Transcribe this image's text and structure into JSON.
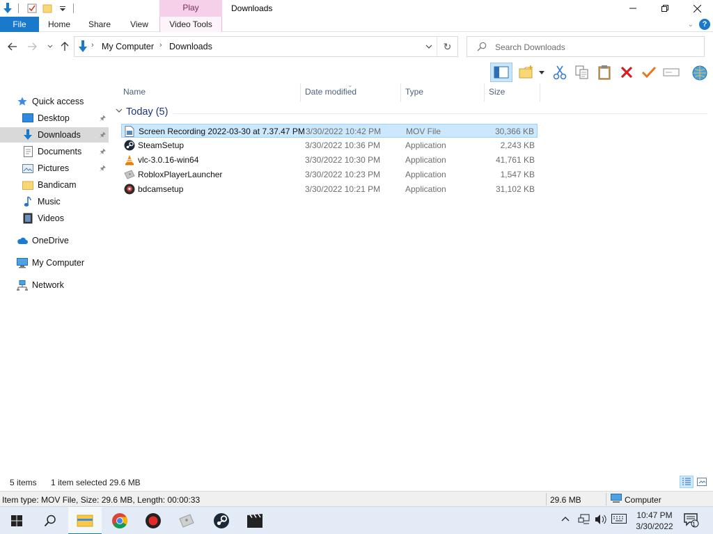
{
  "window": {
    "title": "Downloads",
    "context_tab": "Play"
  },
  "ribbon": {
    "tabs": [
      "File",
      "Home",
      "Share",
      "View",
      "Video Tools"
    ]
  },
  "address": {
    "crumbs": [
      "My Computer",
      "Downloads"
    ]
  },
  "search": {
    "placeholder": "Search Downloads"
  },
  "nav": {
    "items": [
      {
        "label": "Quick access",
        "icon": "star-icon"
      },
      {
        "label": "Desktop",
        "icon": "desktop-icon",
        "pinned": true
      },
      {
        "label": "Downloads",
        "icon": "download-arrow-icon",
        "pinned": true,
        "selected": true
      },
      {
        "label": "Documents",
        "icon": "documents-icon",
        "pinned": true
      },
      {
        "label": "Pictures",
        "icon": "pictures-icon",
        "pinned": true
      },
      {
        "label": "Bandicam",
        "icon": "folder-icon"
      },
      {
        "label": "Music",
        "icon": "music-note-icon"
      },
      {
        "label": "Videos",
        "icon": "film-icon"
      },
      {
        "label": "OneDrive",
        "icon": "cloud-icon"
      },
      {
        "label": "My Computer",
        "icon": "computer-icon"
      },
      {
        "label": "Network",
        "icon": "network-icon"
      }
    ]
  },
  "columns": {
    "name": "Name",
    "date": "Date modified",
    "type": "Type",
    "size": "Size"
  },
  "group": {
    "label": "Today (5)"
  },
  "files": [
    {
      "name": "Screen Recording 2022-03-30 at 7.37.47 PM",
      "date": "3/30/2022 10:42 PM",
      "type": "MOV File",
      "size": "30,366 KB",
      "icon": "video-file-icon",
      "selected": true
    },
    {
      "name": "SteamSetup",
      "date": "3/30/2022 10:36 PM",
      "type": "Application",
      "size": "2,243 KB",
      "icon": "steam-icon"
    },
    {
      "name": "vlc-3.0.16-win64",
      "date": "3/30/2022 10:30 PM",
      "type": "Application",
      "size": "41,761 KB",
      "icon": "vlc-cone-icon"
    },
    {
      "name": "RobloxPlayerLauncher",
      "date": "3/30/2022 10:23 PM",
      "type": "Application",
      "size": "1,547 KB",
      "icon": "roblox-icon"
    },
    {
      "name": "bdcamsetup",
      "date": "3/30/2022 10:21 PM",
      "type": "Application",
      "size": "31,102 KB",
      "icon": "bandicam-icon"
    }
  ],
  "status": {
    "items_count": "5 items",
    "selected": "1 item selected",
    "selected_size": "29.6 MB",
    "detail": "Item type: MOV File, Size: 29.6 MB, Length: 00:00:33",
    "size_right": "29.6 MB",
    "location": "Computer"
  },
  "taskbar": {
    "time": "10:47 PM",
    "date": "3/30/2022",
    "notifications": "1"
  },
  "colors": {
    "accent": "#1979ca",
    "selection": "#cce8ff",
    "group_header": "#1e3287"
  }
}
